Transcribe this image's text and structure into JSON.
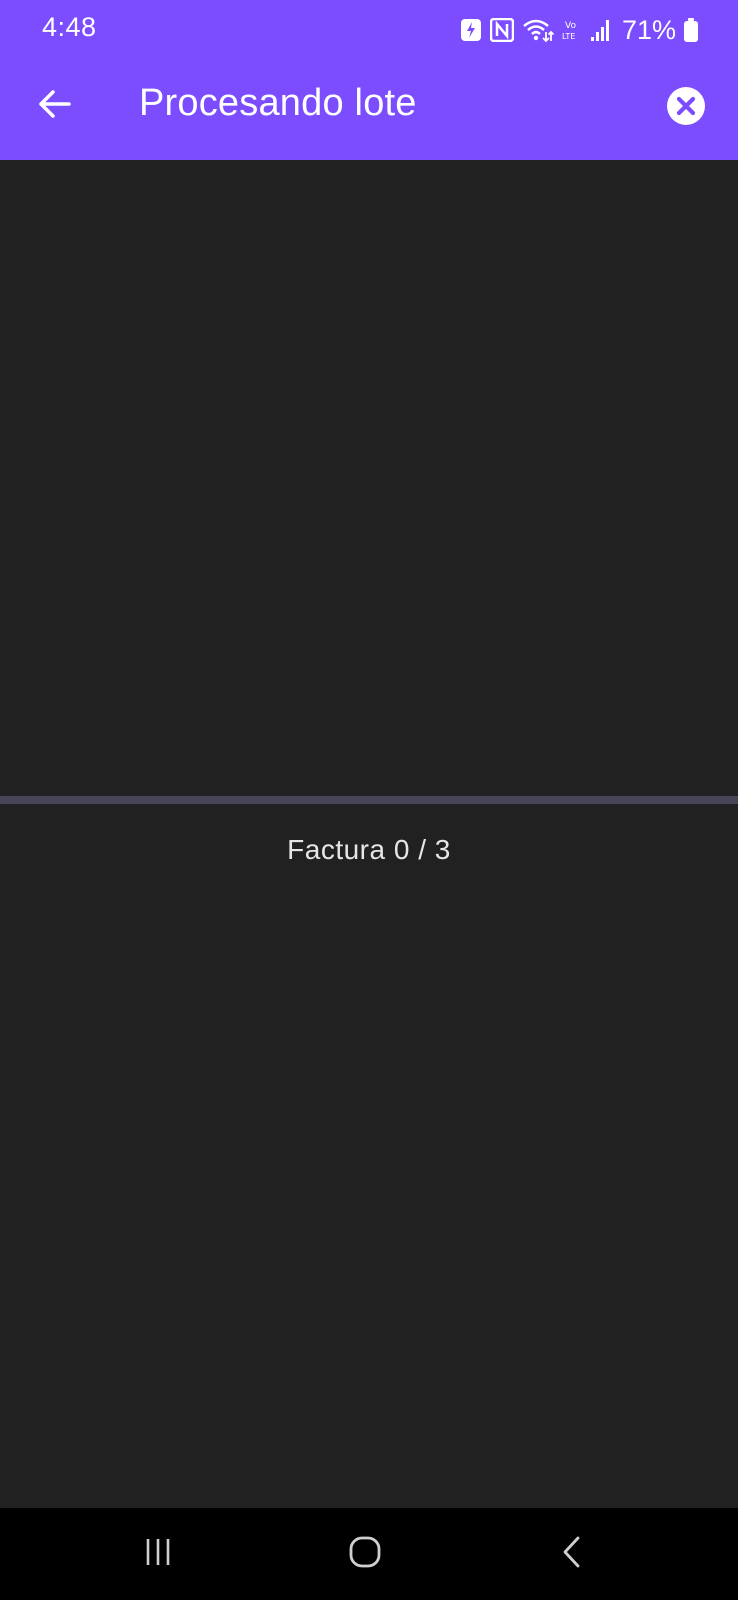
{
  "status_bar": {
    "time": "4:48",
    "battery_percent": "71%",
    "icons": [
      "battery-saver-icon",
      "nfc-icon",
      "wifi-icon",
      "volte-icon",
      "signal-icon",
      "battery-icon"
    ]
  },
  "app_bar": {
    "title": "Procesando lote",
    "back_icon": "arrow-back-icon",
    "close_icon": "close-circle-icon"
  },
  "progress": {
    "current": 0,
    "total": 3,
    "fraction": 0,
    "counter_text": "Factura 0 / 3"
  },
  "nav_bar": {
    "icons": [
      "recents-icon",
      "home-icon",
      "back-icon"
    ]
  },
  "colors": {
    "accent": "#7c4dff",
    "background": "#212121",
    "track": "#4a4458",
    "nav_background": "#000000"
  }
}
